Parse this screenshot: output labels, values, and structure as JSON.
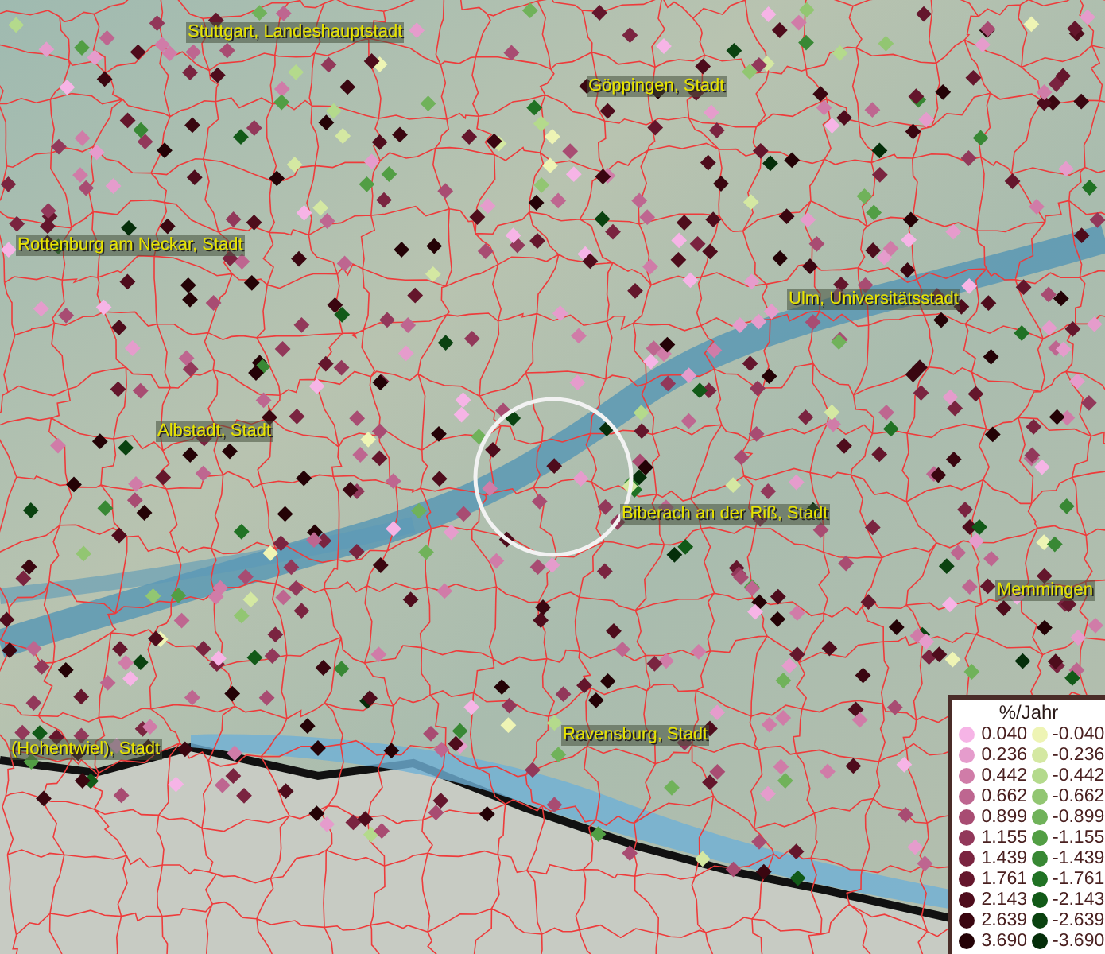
{
  "map": {
    "places": [
      {
        "name": "Stuttgart, Landeshauptstadt"
      },
      {
        "name": "Göppingen, Stadt"
      },
      {
        "name": "Rottenburg am Neckar, Stadt"
      },
      {
        "name": "Ulm, Universitätsstadt"
      },
      {
        "name": "Albstadt, Stadt"
      },
      {
        "name": "Biberach an der Riß, Stadt"
      },
      {
        "name": "Memmingen"
      },
      {
        "name": "Ravensburg, Stadt"
      },
      {
        "name": "(Hohentwiel), Stadt"
      }
    ]
  },
  "legend": {
    "title": "%/Jahr",
    "rows": [
      {
        "gain": {
          "label": "0.040",
          "color": "#f6b4e6"
        },
        "loss": {
          "label": "-0.040",
          "color": "#eef4b4"
        }
      },
      {
        "gain": {
          "label": "0.236",
          "color": "#e59ccc"
        },
        "loss": {
          "label": "-0.236",
          "color": "#d4e8a2"
        }
      },
      {
        "gain": {
          "label": "0.442",
          "color": "#d07ca8"
        },
        "loss": {
          "label": "-0.442",
          "color": "#b4da8c"
        }
      },
      {
        "gain": {
          "label": "0.662",
          "color": "#be6690"
        },
        "loss": {
          "label": "-0.662",
          "color": "#92c672"
        }
      },
      {
        "gain": {
          "label": "0.899",
          "color": "#a84c72"
        },
        "loss": {
          "label": "-0.899",
          "color": "#70b25a"
        }
      },
      {
        "gain": {
          "label": "1.155",
          "color": "#92385a"
        },
        "loss": {
          "label": "-1.155",
          "color": "#529e44"
        }
      },
      {
        "gain": {
          "label": "1.439",
          "color": "#7a2440"
        },
        "loss": {
          "label": "-1.439",
          "color": "#388834"
        }
      },
      {
        "gain": {
          "label": "1.761",
          "color": "#64162c"
        },
        "loss": {
          "label": "-1.761",
          "color": "#207224"
        }
      },
      {
        "gain": {
          "label": "2.143",
          "color": "#4e0c1c"
        },
        "loss": {
          "label": "-2.143",
          "color": "#125a18"
        }
      },
      {
        "gain": {
          "label": "2.639",
          "color": "#3a0610"
        },
        "loss": {
          "label": "-2.639",
          "color": "#0a4210"
        }
      },
      {
        "gain": {
          "label": "3.690",
          "color": "#240206"
        },
        "loss": {
          "label": "-3.690",
          "color": "#052e0a"
        }
      }
    ]
  }
}
